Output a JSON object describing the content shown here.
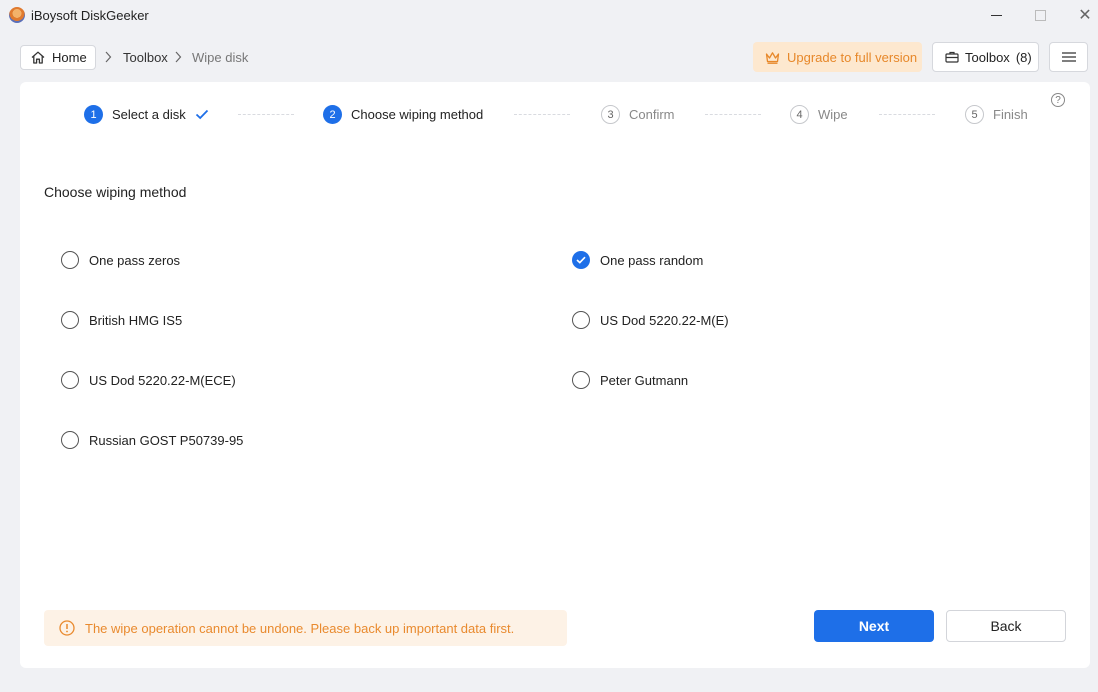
{
  "window": {
    "title": "iBoysoft DiskGeeker",
    "close_glyph": "✕"
  },
  "nav": {
    "home_label": "Home",
    "breadcrumb": [
      "Toolbox",
      "Wipe disk"
    ],
    "upgrade_label": "Upgrade to full version",
    "toolbox_label": "Toolbox",
    "toolbox_count": "(8)",
    "help_glyph": "?"
  },
  "steps": [
    {
      "num": "1",
      "label": "Select a disk",
      "state": "done"
    },
    {
      "num": "2",
      "label": "Choose wiping method",
      "state": "active"
    },
    {
      "num": "3",
      "label": "Confirm",
      "state": "pending"
    },
    {
      "num": "4",
      "label": "Wipe",
      "state": "pending"
    },
    {
      "num": "5",
      "label": "Finish",
      "state": "pending"
    }
  ],
  "main": {
    "section_title": "Choose wiping method",
    "options": [
      {
        "label": "One pass zeros",
        "checked": false
      },
      {
        "label": "One pass random",
        "checked": true
      },
      {
        "label": "British HMG IS5",
        "checked": false
      },
      {
        "label": "US Dod 5220.22-M(E)",
        "checked": false
      },
      {
        "label": "US Dod 5220.22-M(ECE)",
        "checked": false
      },
      {
        "label": "Peter Gutmann",
        "checked": false
      },
      {
        "label": "Russian GOST P50739-95",
        "checked": false
      }
    ],
    "warning_text": "The wipe operation cannot be undone. Please back up important data first.",
    "next_label": "Next",
    "back_label": "Back"
  },
  "colors": {
    "accent": "#1e6fe8",
    "warning": "#e98a2e",
    "upgrade_bg": "#fde8cf"
  },
  "icons": [
    "app-logo-icon",
    "home-icon",
    "chevron-right-icon",
    "crown-icon",
    "toolbox-icon",
    "hamburger-menu-icon",
    "help-icon",
    "check-icon",
    "warning-icon"
  ]
}
